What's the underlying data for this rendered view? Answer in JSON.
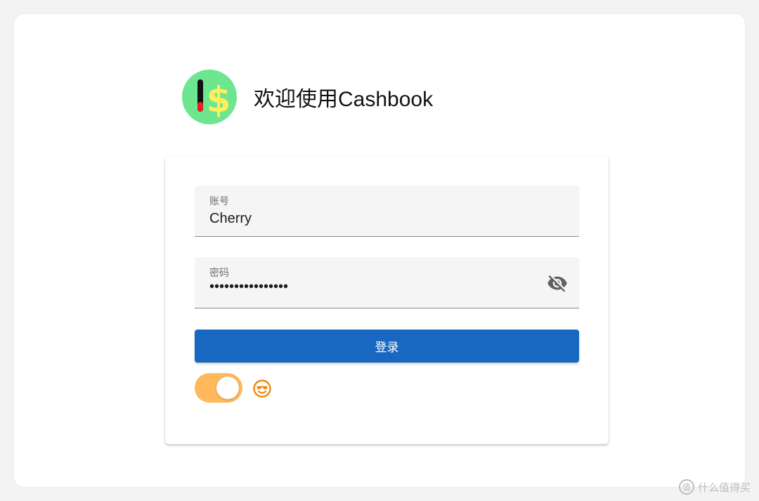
{
  "header": {
    "welcome": "欢迎使用Cashbook",
    "logo_icon": "dollar-thermometer-logo"
  },
  "form": {
    "account": {
      "label": "账号",
      "value": "Cherry"
    },
    "password": {
      "label": "密码",
      "value": "••••••••••••••••",
      "visibility_icon": "eye-off-icon"
    },
    "login_label": "登录",
    "theme_toggle": {
      "state": "on",
      "icon": "sunglasses-emoji-icon"
    }
  },
  "colors": {
    "primary": "#1867c0",
    "toggle_track": "#ffb85c",
    "emoji": "#f0890f",
    "logo_bg": "#6ee58f",
    "logo_dollar": "#ffef5a"
  },
  "watermark": {
    "text": "什么值得买"
  }
}
